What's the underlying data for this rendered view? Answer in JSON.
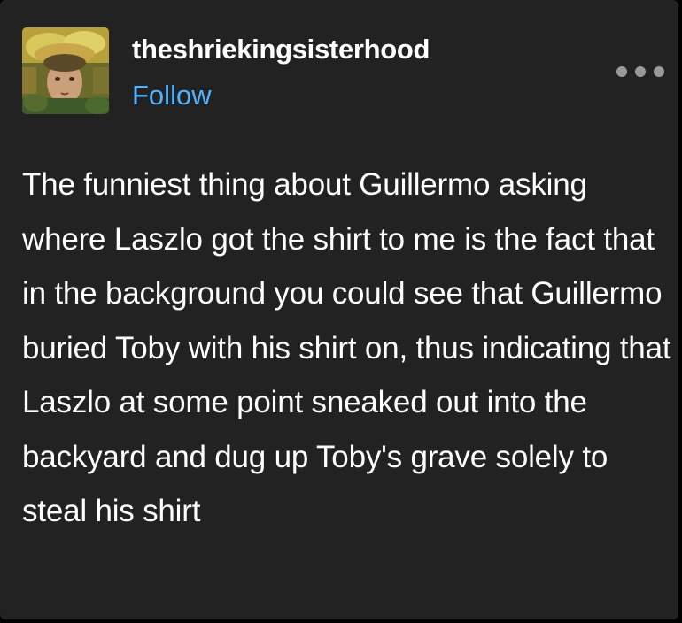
{
  "post": {
    "username": "theshriekingsisterhood",
    "follow_label": "Follow",
    "more_icon": "ellipsis-icon",
    "avatar_icon": "avatar-painting-portrait",
    "text": "The funniest thing about Guillermo asking where Laszlo got the shirt to me is the fact that in the background you could see that Guillermo buried Toby with his shirt on, thus indicating that Laszlo at some point sneaked out into the backyard and dug up Toby's grave solely to steal his shirt"
  },
  "colors": {
    "card_background": "#222222",
    "page_background": "#000000",
    "text": "#ffffff",
    "follow_link": "#4fb3ff",
    "more_dots": "#9a9a9a"
  }
}
